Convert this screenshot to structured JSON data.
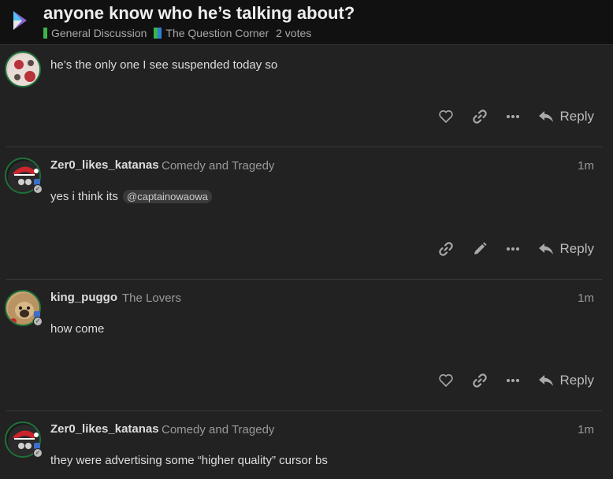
{
  "topic": {
    "title": "anyone know who he’s talking about?",
    "categories": [
      {
        "label": "General Discussion",
        "color": "#3ab54a"
      },
      {
        "label": "The Question Corner",
        "colors": [
          "#3ab54a",
          "#2f7fd0"
        ]
      }
    ],
    "votes": "2 votes"
  },
  "posts": [
    {
      "body": "he’s the only one I see suspended today so",
      "actions": [
        "like-icon",
        "link-icon",
        "more-icon"
      ],
      "reply_label": "Reply"
    },
    {
      "username": "Zer0_likes_katanas",
      "user_title": "Comedy and Tragedy",
      "date": "1m",
      "body": "yes i think its",
      "mention": "@captainowaowa",
      "actions": [
        "link-icon",
        "edit-icon",
        "more-icon"
      ],
      "reply_label": "Reply"
    },
    {
      "username": "king_puggo",
      "user_title": "The Lovers",
      "date": "1m",
      "body": "how come",
      "actions": [
        "like-icon",
        "link-icon",
        "more-icon"
      ],
      "reply_label": "Reply"
    },
    {
      "username": "Zer0_likes_katanas",
      "user_title": "Comedy and Tragedy",
      "date": "1m",
      "body": "they were advertising some “higher quality” cursor bs"
    }
  ],
  "colors": {
    "background": "#222222",
    "header": "#111111",
    "avatar_ring": "#1f6f3a",
    "text": "#dddddd",
    "muted": "#9a9a9a"
  }
}
